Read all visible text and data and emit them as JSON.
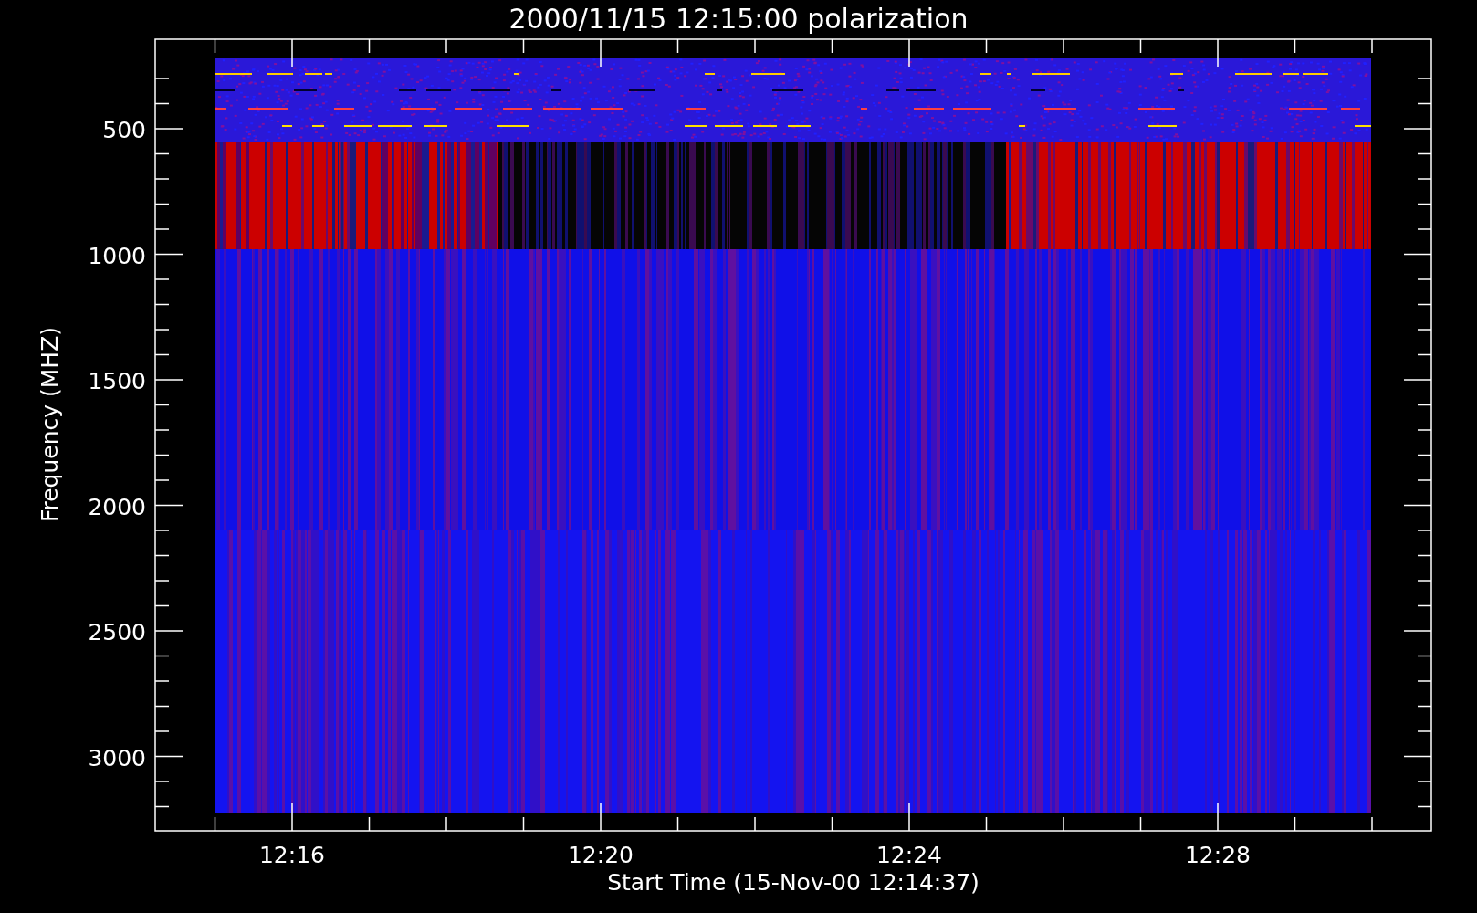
{
  "title": "2000/11/15 12:15:00 polarization",
  "y_axis": {
    "label": "Frequency (MHZ)",
    "ticks": [
      "500",
      "1000",
      "1500",
      "2000",
      "2500",
      "3000"
    ]
  },
  "x_axis": {
    "label": "Start Time (15-Nov-00 12:14:37)",
    "ticks": [
      "12:16",
      "12:20",
      "12:24",
      "12:28"
    ]
  }
}
